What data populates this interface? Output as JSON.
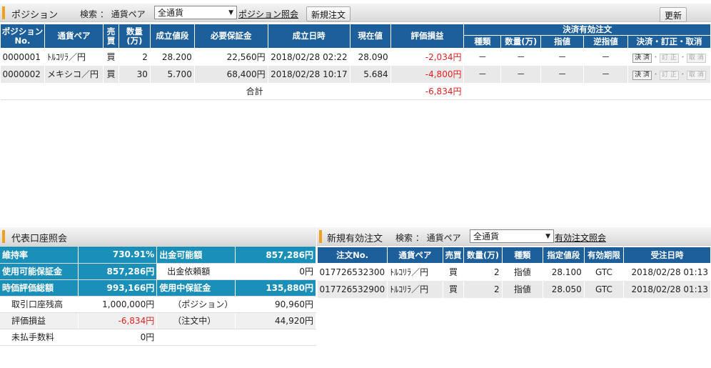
{
  "position": {
    "title": "ポジション",
    "search_label": "検索 ： 通貨ペア",
    "filter": "全通貨",
    "link": "ポジション照会",
    "new_order_btn": "新規注文",
    "refresh_btn": "更新",
    "headers": {
      "no": "ポジション No.",
      "pair": "通貨ペア",
      "side": "売 買",
      "qty": "数量 (万)",
      "price": "成立値段",
      "margin": "必要保証金",
      "datetime": "成立日時",
      "current": "現在値",
      "pl": "評価損益",
      "settle_group": "決済有効注文",
      "kind": "種類",
      "sqty": "数量(万)",
      "limit": "指値",
      "stop": "逆指値",
      "actions": "決済・訂正・取消"
    },
    "rows": [
      {
        "no": "0000001",
        "pair": "ﾄﾙｺﾘﾗ／円",
        "side": "買",
        "qty": "2",
        "price": "28.200",
        "margin": "22,560円",
        "datetime": "2018/02/28 02:22",
        "current": "28.090",
        "pl": "-2,034円",
        "kind": "－",
        "sqty": "－",
        "limit": "－",
        "stop": "－",
        "a1": "決 済",
        "a2": "訂 正",
        "a3": "取 消"
      },
      {
        "no": "0000002",
        "pair": "メキシコ／円",
        "side": "買",
        "qty": "30",
        "price": "5.700",
        "margin": "68,400円",
        "datetime": "2018/02/28 10:17",
        "current": "5.684",
        "pl": "-4,800円",
        "kind": "－",
        "sqty": "－",
        "limit": "－",
        "stop": "－",
        "a1": "決 済",
        "a2": "訂 正",
        "a3": "取 消"
      }
    ],
    "total_label": "合計",
    "total_pl": "-6,834円"
  },
  "account": {
    "title": "代表口座照会",
    "rows": [
      {
        "l1": "維持率",
        "v1": "730.91%",
        "l2": "出金可能額",
        "v2": "857,286円"
      },
      {
        "l1": "使用可能保証金",
        "v1": "857,286円",
        "l2": "出金依頼額",
        "v2": "0円"
      },
      {
        "l1": "時価評価総額",
        "v1": "993,166円",
        "l2": "使用中保証金",
        "v2": "135,880円"
      },
      {
        "l1": "取引口座残高",
        "v1": "1,000,000円",
        "l2": "（ポジション）",
        "v2": "90,960円"
      },
      {
        "l1": "評価損益",
        "v1": "-6,834円",
        "l2": "（注文中）",
        "v2": "44,920円"
      },
      {
        "l1": "未払手数料",
        "v1": "0円",
        "l2": "",
        "v2": ""
      }
    ]
  },
  "orders": {
    "title": "新規有効注文",
    "search_label": "検索 ： 通貨ペア",
    "filter": "全通貨",
    "link": "有効注文照会",
    "headers": {
      "no": "注文No.",
      "pair": "通貨ペア",
      "side": "売買",
      "qty": "数量(万)",
      "kind": "種類",
      "price": "指定値段",
      "expiry": "有効期限",
      "datetime": "受注日時"
    },
    "rows": [
      {
        "no": "017726532300",
        "pair": "ﾄﾙｺﾘﾗ／円",
        "side": "買",
        "qty": "2",
        "kind": "指値",
        "price": "28.100",
        "expiry": "GTC",
        "datetime": "2018/02/28 01:13"
      },
      {
        "no": "017726532900",
        "pair": "ﾄﾙｺﾘﾗ／円",
        "side": "買",
        "qty": "2",
        "kind": "指値",
        "price": "28.050",
        "expiry": "GTC",
        "datetime": "2018/02/28 01:13"
      }
    ]
  },
  "colors": {
    "header_blue": "#1d5f9b",
    "account_blue": "#1a8fb8",
    "negative": "#e02020",
    "accent": "#f0a020"
  }
}
